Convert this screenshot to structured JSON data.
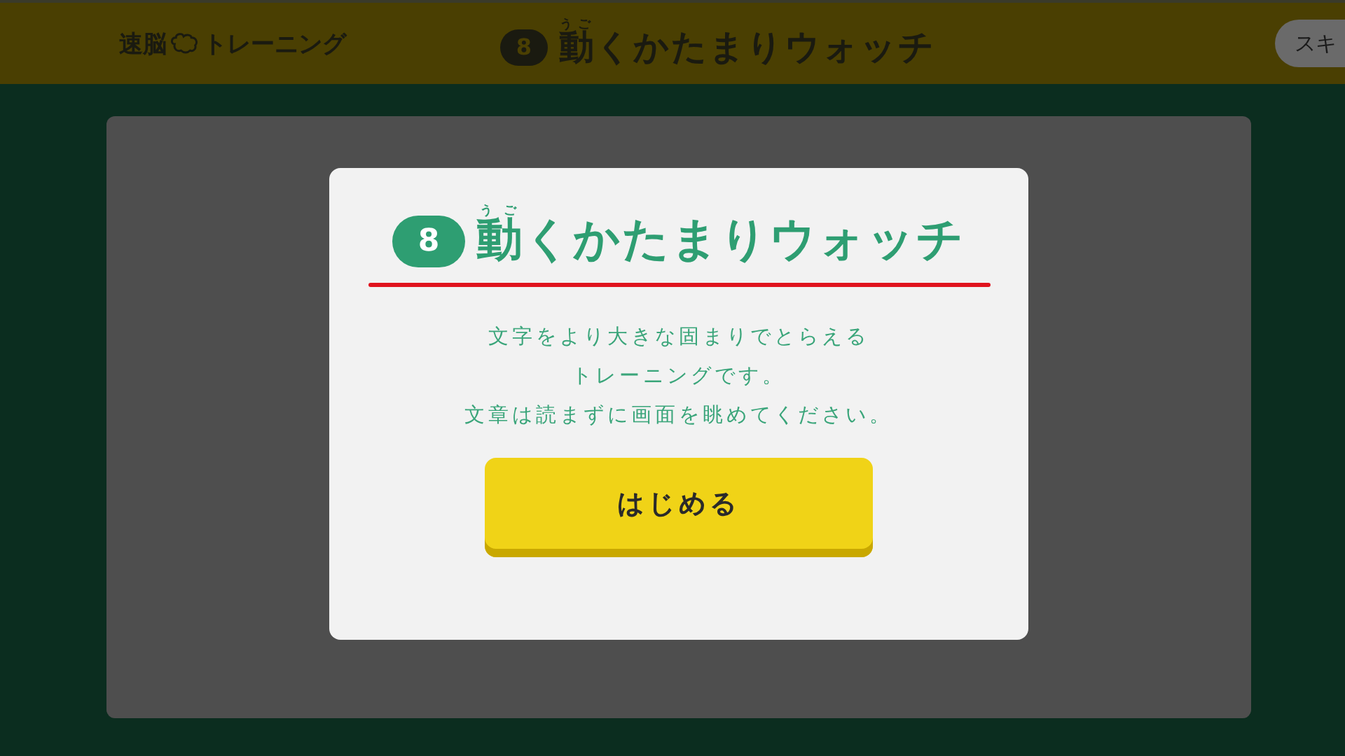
{
  "header": {
    "logo_left": "速脳",
    "logo_right": "トレーニング",
    "number": "8",
    "title_ruby_base": "動",
    "title_ruby": "うご",
    "title_rest": "くかたまりウォッチ",
    "skip_button": "スキ"
  },
  "dialog": {
    "number": "8",
    "title_ruby_base": "動",
    "title_ruby": "うご",
    "title_rest": "くかたまりウォッチ",
    "description": [
      "文字をより大きな固まりでとらえる",
      "トレーニングです。",
      "文章は読まずに画面を眺めてください。"
    ],
    "start_button": "はじめる"
  }
}
